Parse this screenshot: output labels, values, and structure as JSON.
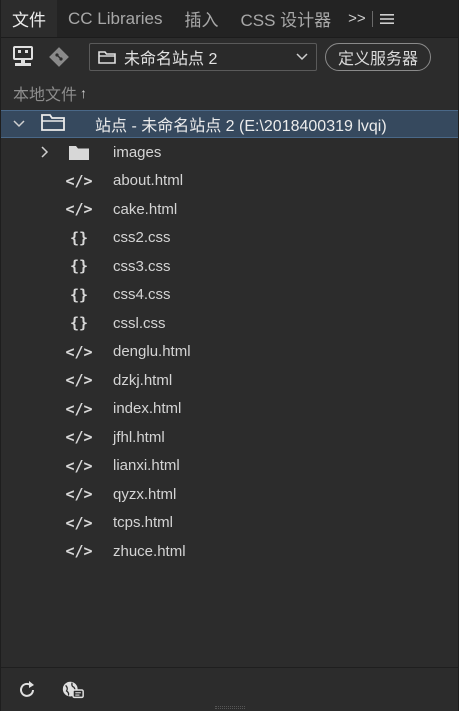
{
  "tabs": [
    {
      "label": "文件",
      "active": true
    },
    {
      "label": "CC Libraries",
      "active": false
    },
    {
      "label": "插入",
      "active": false
    },
    {
      "label": "CSS 设计器",
      "active": false
    }
  ],
  "tab_overflow": ">>",
  "toolbar": {
    "site_name": "未命名站点 2",
    "define_server_label": "定义服务器"
  },
  "local_files_header": "本地文件",
  "local_files_sort_arrow": "↑",
  "tree": {
    "root_label": "站点 - 未命名站点 2 (E:\\2018400319 lvqi)",
    "items": [
      {
        "name": "images",
        "type": "folder"
      },
      {
        "name": "about.html",
        "type": "html"
      },
      {
        "name": "cake.html",
        "type": "html"
      },
      {
        "name": "css2.css",
        "type": "css"
      },
      {
        "name": "css3.css",
        "type": "css"
      },
      {
        "name": "css4.css",
        "type": "css"
      },
      {
        "name": "cssl.css",
        "type": "css"
      },
      {
        "name": "denglu.html",
        "type": "html"
      },
      {
        "name": "dzkj.html",
        "type": "html"
      },
      {
        "name": "index.html",
        "type": "html"
      },
      {
        "name": "jfhl.html",
        "type": "html"
      },
      {
        "name": "lianxi.html",
        "type": "html"
      },
      {
        "name": "qyzx.html",
        "type": "html"
      },
      {
        "name": "tcps.html",
        "type": "html"
      },
      {
        "name": "zhuce.html",
        "type": "html"
      }
    ]
  },
  "icons": {
    "html": "</>",
    "css": "{}"
  },
  "colors": {
    "selection": "#36495e",
    "panel": "#2c2c2c",
    "tabbar": "#232323"
  }
}
